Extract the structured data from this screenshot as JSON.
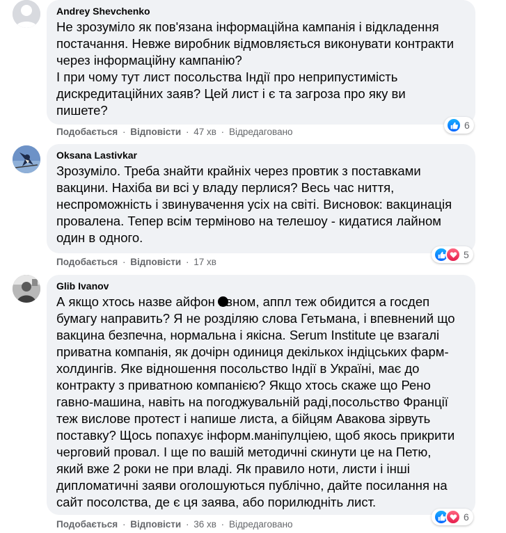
{
  "actions": {
    "like_label": "Подобається",
    "reply_label": "Відповісти",
    "separator": "·",
    "edited_label": "Відредаговано"
  },
  "comments": [
    {
      "author": "Andrey Shevchenko",
      "text": "Не зрозуміло як пов'язана інформаційна кампанія і відкладення\nпостачання. Невже виробник відмовляється виконувати контракти\nчерез інформаційну кампанію?\nІ при чому тут лист посольства Індії про неприпустимість\nдискредитаційних заяв? Цей лист і є та загроза про яку ви\nпишете?",
      "time": "47 хв",
      "edited": true,
      "reaction_count": "6",
      "reactions": [
        "like-icon"
      ]
    },
    {
      "author": "Oksana Lastivkar",
      "text": "Зрозуміло. Треба знайти крайніх через провтик з поставками\nвакцини. Нахіба ви всі у владу перлися? Весь час ниття,\nнеспроможність і звинувачення усіх на світі. Висновок: вакцинація\nпровалена. Тепер всім терміново на телешоу - кидатися лайном\nодин в одного.",
      "time": "17 хв",
      "edited": false,
      "reaction_count": "5",
      "reactions": [
        "like-icon",
        "love-icon"
      ]
    },
    {
      "author": "Glib Ivanov",
      "text": "А якщо хтось назве айфон   авном, аппл теж обидится а госдеп\nбумагу направить? Я не розділяю слова Гетьмана, і впевнений що\nвакцина безпечна, нормальна і якісна. Serum Institute це взагалі\nприватна компанія, як дочірн одиниця декількох індіцських фарм-\nхолдингів. Яке відношення посольство Індії в Україні, має до\nконтракту з приватною компанією? Якщо хтось скаже що Рено\nгавно-машина, навіть на погоджувальній раді,посольство Франції\nтеж вислове протест і напише листа, а бійцям Авакова зірвуть\nпоставку? Щось попахує інформ.маніпулціею, щоб якось прикрити\nчерговий провал. І ще по вашій методичні скинути це на Петю,\nякий вже 2 роки не при владі. Як правило ноти, листи і інші\nдипломатичні заяви оголошуються публічно, дайте посилання на\nсайт посолства, де є ця заява, або порилюдніть лист.",
      "time": "36 хв",
      "edited": true,
      "reaction_count": "6",
      "reactions": [
        "like-icon",
        "love-icon"
      ]
    }
  ]
}
